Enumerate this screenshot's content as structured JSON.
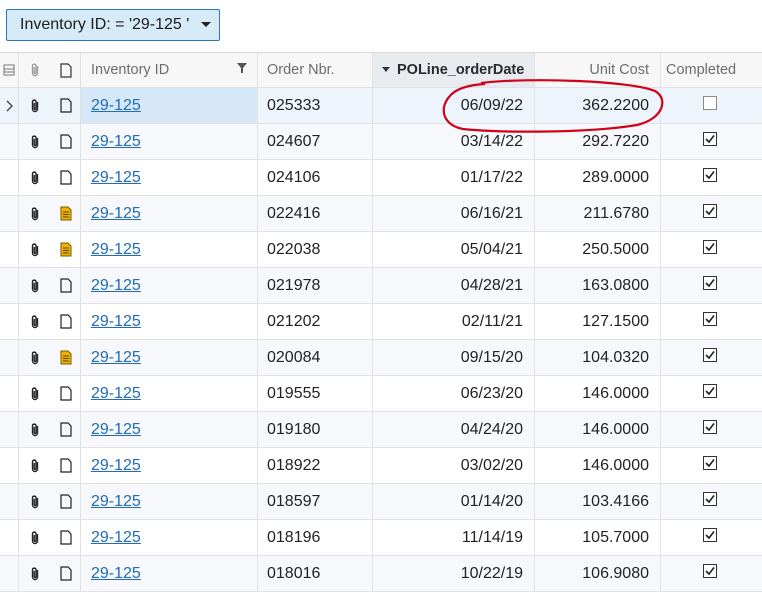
{
  "filter": {
    "label": "Inventory ID: = '29-125 '"
  },
  "columns": {
    "inventory_id": "Inventory ID",
    "order_nbr": "Order Nbr.",
    "order_date": "POLine_orderDate",
    "unit_cost": "Unit Cost",
    "completed": "Completed"
  },
  "rows": [
    {
      "inventory_id": "29-125",
      "order_nbr": "025333",
      "order_date": "06/09/22",
      "unit_cost": "362.2200",
      "completed": false,
      "note": "empty"
    },
    {
      "inventory_id": "29-125",
      "order_nbr": "024607",
      "order_date": "03/14/22",
      "unit_cost": "292.7220",
      "completed": true,
      "note": "empty"
    },
    {
      "inventory_id": "29-125",
      "order_nbr": "024106",
      "order_date": "01/17/22",
      "unit_cost": "289.0000",
      "completed": true,
      "note": "empty"
    },
    {
      "inventory_id": "29-125",
      "order_nbr": "022416",
      "order_date": "06/16/21",
      "unit_cost": "211.6780",
      "completed": true,
      "note": "filled"
    },
    {
      "inventory_id": "29-125",
      "order_nbr": "022038",
      "order_date": "05/04/21",
      "unit_cost": "250.5000",
      "completed": true,
      "note": "filled"
    },
    {
      "inventory_id": "29-125",
      "order_nbr": "021978",
      "order_date": "04/28/21",
      "unit_cost": "163.0800",
      "completed": true,
      "note": "empty"
    },
    {
      "inventory_id": "29-125",
      "order_nbr": "021202",
      "order_date": "02/11/21",
      "unit_cost": "127.1500",
      "completed": true,
      "note": "empty"
    },
    {
      "inventory_id": "29-125",
      "order_nbr": "020084",
      "order_date": "09/15/20",
      "unit_cost": "104.0320",
      "completed": true,
      "note": "filled"
    },
    {
      "inventory_id": "29-125",
      "order_nbr": "019555",
      "order_date": "06/23/20",
      "unit_cost": "146.0000",
      "completed": true,
      "note": "empty"
    },
    {
      "inventory_id": "29-125",
      "order_nbr": "019180",
      "order_date": "04/24/20",
      "unit_cost": "146.0000",
      "completed": true,
      "note": "empty"
    },
    {
      "inventory_id": "29-125",
      "order_nbr": "018922",
      "order_date": "03/02/20",
      "unit_cost": "146.0000",
      "completed": true,
      "note": "empty"
    },
    {
      "inventory_id": "29-125",
      "order_nbr": "018597",
      "order_date": "01/14/20",
      "unit_cost": "103.4166",
      "completed": true,
      "note": "empty"
    },
    {
      "inventory_id": "29-125",
      "order_nbr": "018196",
      "order_date": "11/14/19",
      "unit_cost": "105.7000",
      "completed": true,
      "note": "empty"
    },
    {
      "inventory_id": "29-125",
      "order_nbr": "018016",
      "order_date": "10/22/19",
      "unit_cost": "106.9080",
      "completed": true,
      "note": "empty"
    }
  ],
  "icons": {
    "attachment": "paperclip-icon",
    "note": "note-icon",
    "note_filled": "note-filled-icon",
    "filter": "funnel-icon",
    "sort": "sort-descending-icon",
    "row_selector": "chevron-right-icon"
  },
  "colors": {
    "accent": "#2a77b8",
    "link": "#1f6bb8",
    "note_filled": "#f0b400",
    "annotation": "#d0021b"
  }
}
